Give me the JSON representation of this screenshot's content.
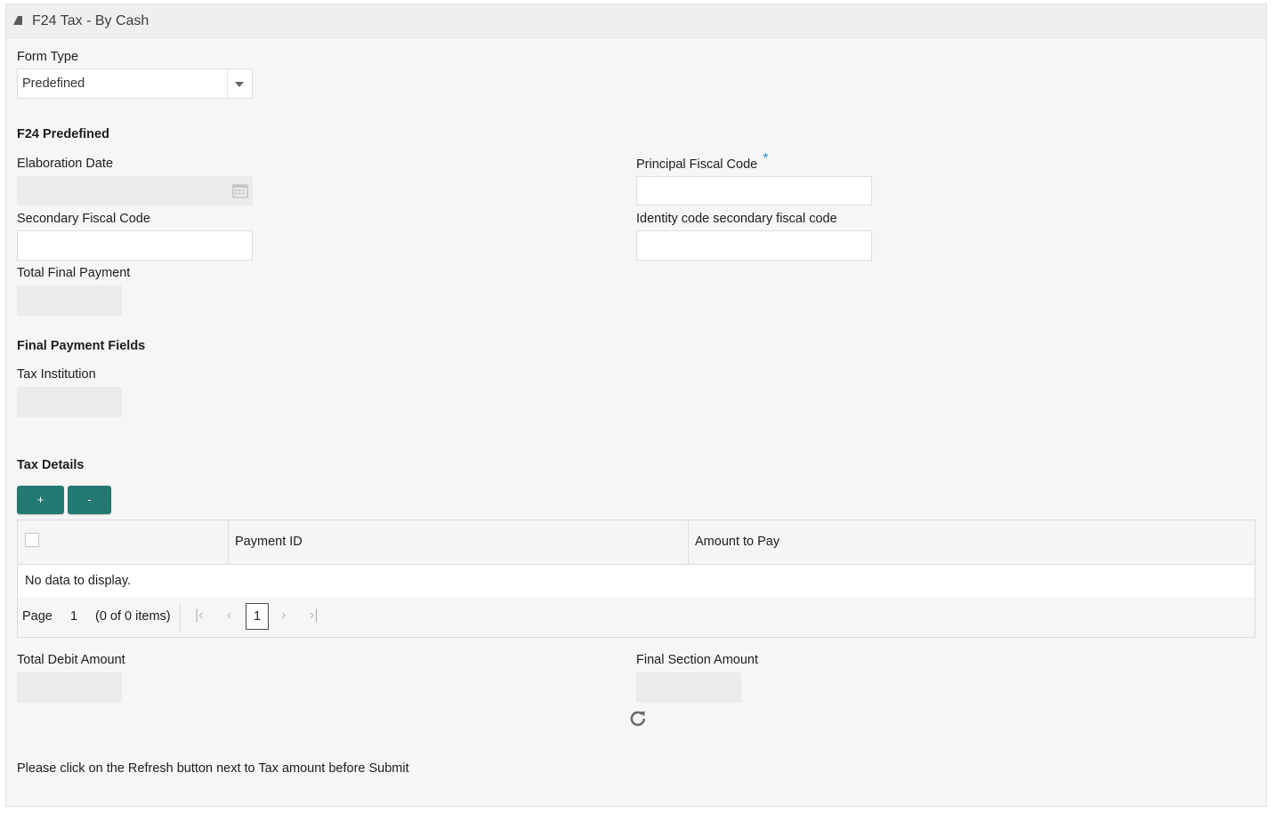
{
  "panel": {
    "title": "F24 Tax - By Cash"
  },
  "form_type": {
    "label": "Form Type",
    "value": "Predefined"
  },
  "f24_predefined": {
    "heading": "F24 Predefined",
    "elaboration_date_label": "Elaboration Date",
    "principal_fiscal_code_label": "Principal Fiscal Code",
    "required_marker": "*",
    "secondary_fiscal_code_label": "Secondary Fiscal Code",
    "identity_code_label": "Identity code secondary fiscal code",
    "total_final_payment_label": "Total Final Payment"
  },
  "final_payment": {
    "heading": "Final Payment Fields",
    "tax_institution_label": "Tax Institution"
  },
  "tax_details": {
    "heading": "Tax Details",
    "add_label": "+",
    "remove_label": "-",
    "columns": [
      "",
      "Payment ID",
      "Amount to Pay"
    ],
    "empty_text": "No data to display.",
    "pager": {
      "page_label": "Page",
      "page_value": "1",
      "items_text": "(0 of 0 items)",
      "current_page": "1"
    }
  },
  "totals": {
    "total_debit_label": "Total Debit Amount",
    "final_section_label": "Final Section Amount"
  },
  "footer_note": "Please click on the Refresh button next to Tax amount before Submit"
}
